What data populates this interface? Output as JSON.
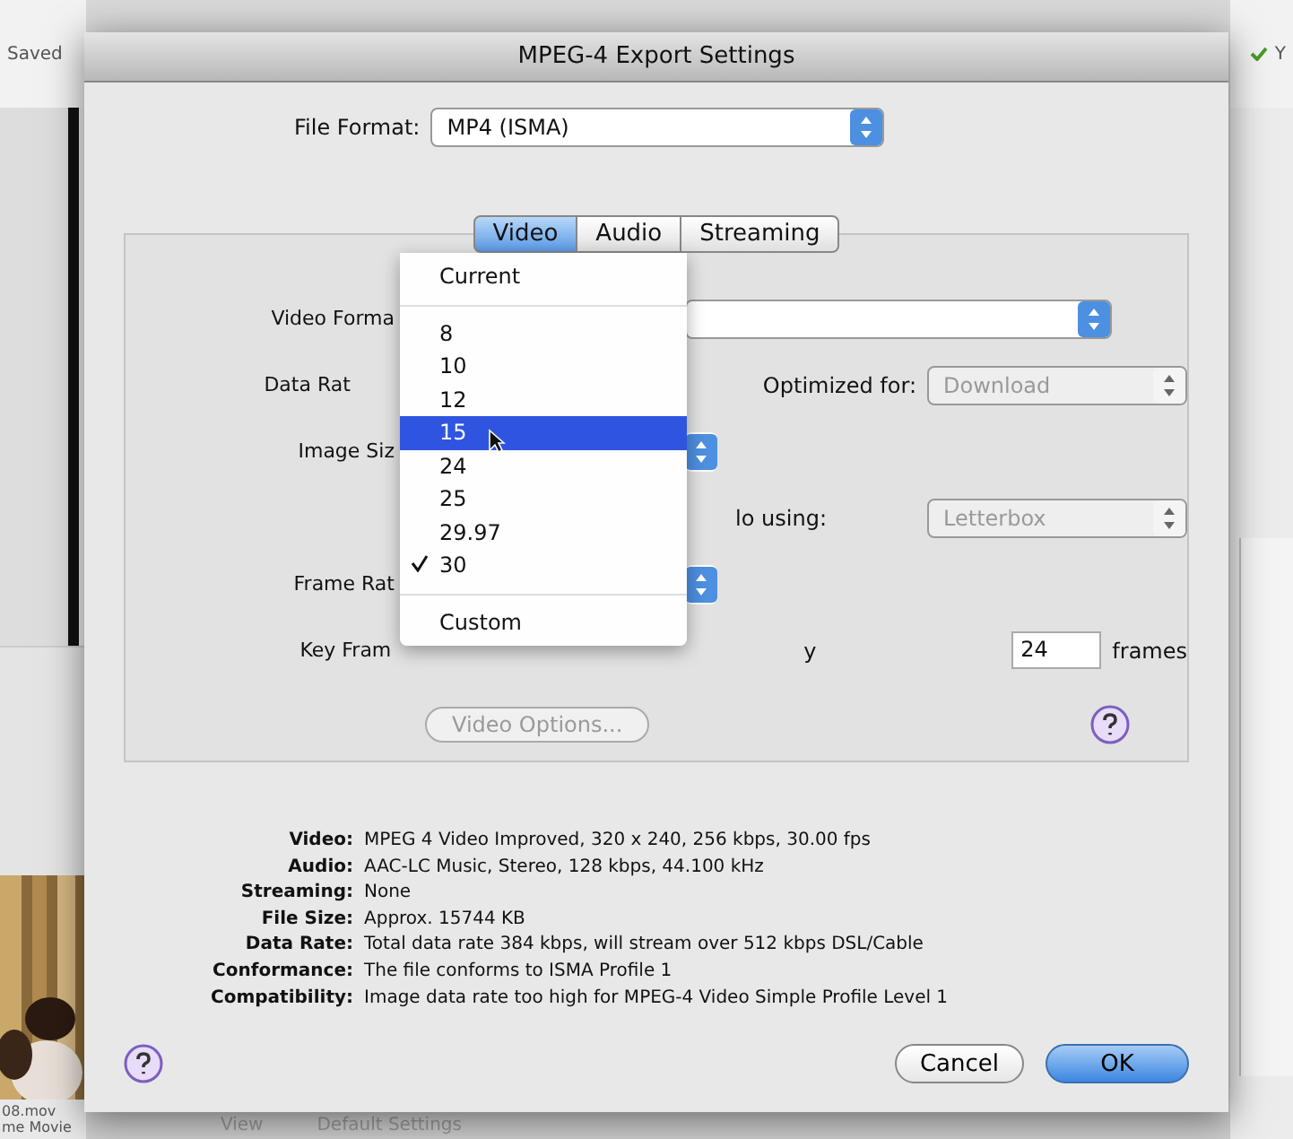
{
  "background_app": {
    "left_label": "Saved",
    "right_label": "Y",
    "file_name": "08.mov",
    "file_caption": "me Movie",
    "bottom_label": "View",
    "bottom_popup": "Default Settings"
  },
  "dialog": {
    "title": "MPEG-4 Export Settings",
    "file_format": {
      "label": "File Format:",
      "value": "MP4 (ISMA)"
    },
    "tabs": [
      {
        "label": "Video",
        "selected": true
      },
      {
        "label": "Audio",
        "selected": false
      },
      {
        "label": "Streaming",
        "selected": false
      }
    ],
    "rows": [
      {
        "label": "Video Forma",
        "kind": "popup"
      },
      {
        "label": "Data Rat",
        "kind": "rate",
        "right_label": "Optimized for:",
        "right_value": "Download"
      },
      {
        "label": "Image Siz",
        "kind": "popup_short"
      },
      {
        "label": "",
        "kind": "aspect",
        "right_label": "lo using:",
        "right_value": "Letterbox"
      },
      {
        "label": "Frame Rat",
        "kind": "popup_short"
      },
      {
        "label": "Key Fram",
        "kind": "keyframe",
        "right_label": "y",
        "right_value": "24",
        "unit": "frames"
      }
    ],
    "menu": [
      {
        "kind": "item",
        "label": "Current",
        "selected": false,
        "checked": false
      },
      {
        "kind": "separator"
      },
      {
        "kind": "item",
        "label": "8",
        "selected": false,
        "checked": false
      },
      {
        "kind": "item",
        "label": "10",
        "selected": false,
        "checked": false
      },
      {
        "kind": "item",
        "label": "12",
        "selected": false,
        "checked": false
      },
      {
        "kind": "item",
        "label": "15",
        "selected": true,
        "checked": false
      },
      {
        "kind": "item",
        "label": "24",
        "selected": false,
        "checked": false
      },
      {
        "kind": "item",
        "label": "25",
        "selected": false,
        "checked": false
      },
      {
        "kind": "item",
        "label": "29.97",
        "selected": false,
        "checked": false
      },
      {
        "kind": "item",
        "label": "30",
        "selected": false,
        "checked": true
      },
      {
        "kind": "separator"
      },
      {
        "kind": "item",
        "label": "Custom",
        "selected": false,
        "checked": false
      }
    ],
    "video_options": {
      "label": "Video Options...",
      "disabled": true
    },
    "summary": [
      {
        "label": "Video:",
        "value": "MPEG 4 Video Improved, 320 x 240, 256 kbps, 30.00 fps"
      },
      {
        "label": "Audio:",
        "value": "AAC-LC Music, Stereo, 128 kbps, 44.100 kHz"
      },
      {
        "label": "Streaming:",
        "value": "None"
      },
      {
        "label": "File Size:",
        "value": "Approx. 15744 KB"
      },
      {
        "label": "Data Rate:",
        "value": "Total data rate 384 kbps, will stream over 512 kbps DSL/Cable"
      },
      {
        "label": "Conformance:",
        "value": "The file conforms to ISMA Profile 1"
      },
      {
        "label": "Compatibility:",
        "value": "Image data rate too high for MPEG-4 Video Simple Profile Level 1"
      }
    ],
    "buttons": [
      {
        "label": "Cancel",
        "kind": "normal"
      },
      {
        "label": "OK",
        "kind": "default"
      }
    ]
  }
}
